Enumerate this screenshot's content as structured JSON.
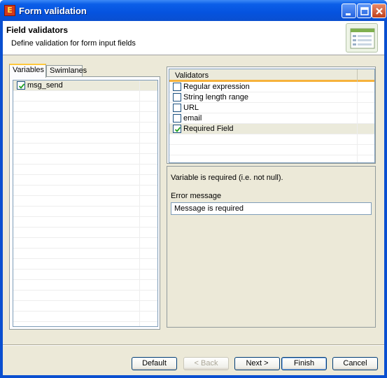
{
  "window": {
    "title": "Form validation"
  },
  "header": {
    "title": "Field validators",
    "description": "Define validation for form input fields"
  },
  "tabs": [
    {
      "label": "Variables",
      "active": true
    },
    {
      "label": "Swimlanes",
      "active": false
    }
  ],
  "variables": [
    {
      "name": "msg_send",
      "checked": true
    }
  ],
  "validators": {
    "header": "Validators",
    "items": [
      {
        "label": "Regular expression",
        "checked": false
      },
      {
        "label": "String length range",
        "checked": false
      },
      {
        "label": "URL",
        "checked": false
      },
      {
        "label": "email",
        "checked": false
      },
      {
        "label": "Required Field",
        "checked": true
      }
    ]
  },
  "detail": {
    "description": "Variable is required (i.e. not null).",
    "error_label": "Error message",
    "error_value": "Message is required"
  },
  "buttons": {
    "default": "Default",
    "back": "< Back",
    "next": "Next >",
    "finish": "Finish",
    "cancel": "Cancel"
  },
  "colors": {
    "titlebar": "#0553df",
    "dialog_bg": "#ece9d8",
    "tab_accent": "#ffc83c",
    "header_underline": "#f6b23c"
  }
}
